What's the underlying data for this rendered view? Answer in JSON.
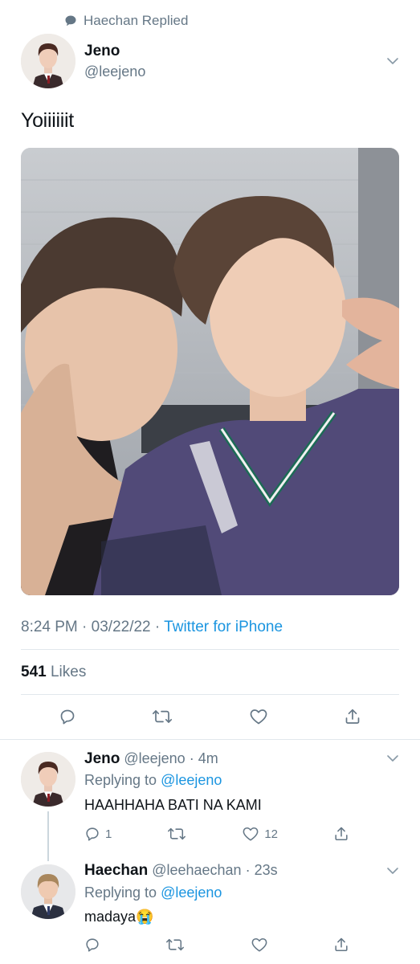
{
  "context": {
    "replied_label": "Haechan Replied"
  },
  "main_tweet": {
    "author_name": "Jeno",
    "author_handle": "@leejeno",
    "text": "Yoiiiiiit",
    "time": "8:24 PM",
    "date": "03/22/22",
    "source": "Twitter for iPhone",
    "likes_count": "541",
    "likes_label": "Likes"
  },
  "replies": [
    {
      "author_name": "Jeno",
      "author_handle": "@leejeno",
      "time_ago": "4m",
      "replying_label": "Replying to",
      "replying_handle": "@leejeno",
      "text": "HAAHHAHA BATI NA KAMI",
      "reply_count": "1",
      "like_count": "12"
    },
    {
      "author_name": "Haechan",
      "author_handle": "@leehaechan",
      "time_ago": "23s",
      "replying_label": "Replying to",
      "replying_handle": "@leejeno",
      "text": "madaya",
      "emoji": "😭"
    }
  ],
  "icons": {
    "context": "speech-bubble-icon",
    "menu": "chevron-down-icon",
    "reply": "reply-icon",
    "retweet": "retweet-icon",
    "like": "heart-icon",
    "share": "share-icon"
  },
  "colors": {
    "link": "#1b95e0",
    "secondary": "#657786",
    "divider": "#e1e8ed"
  }
}
